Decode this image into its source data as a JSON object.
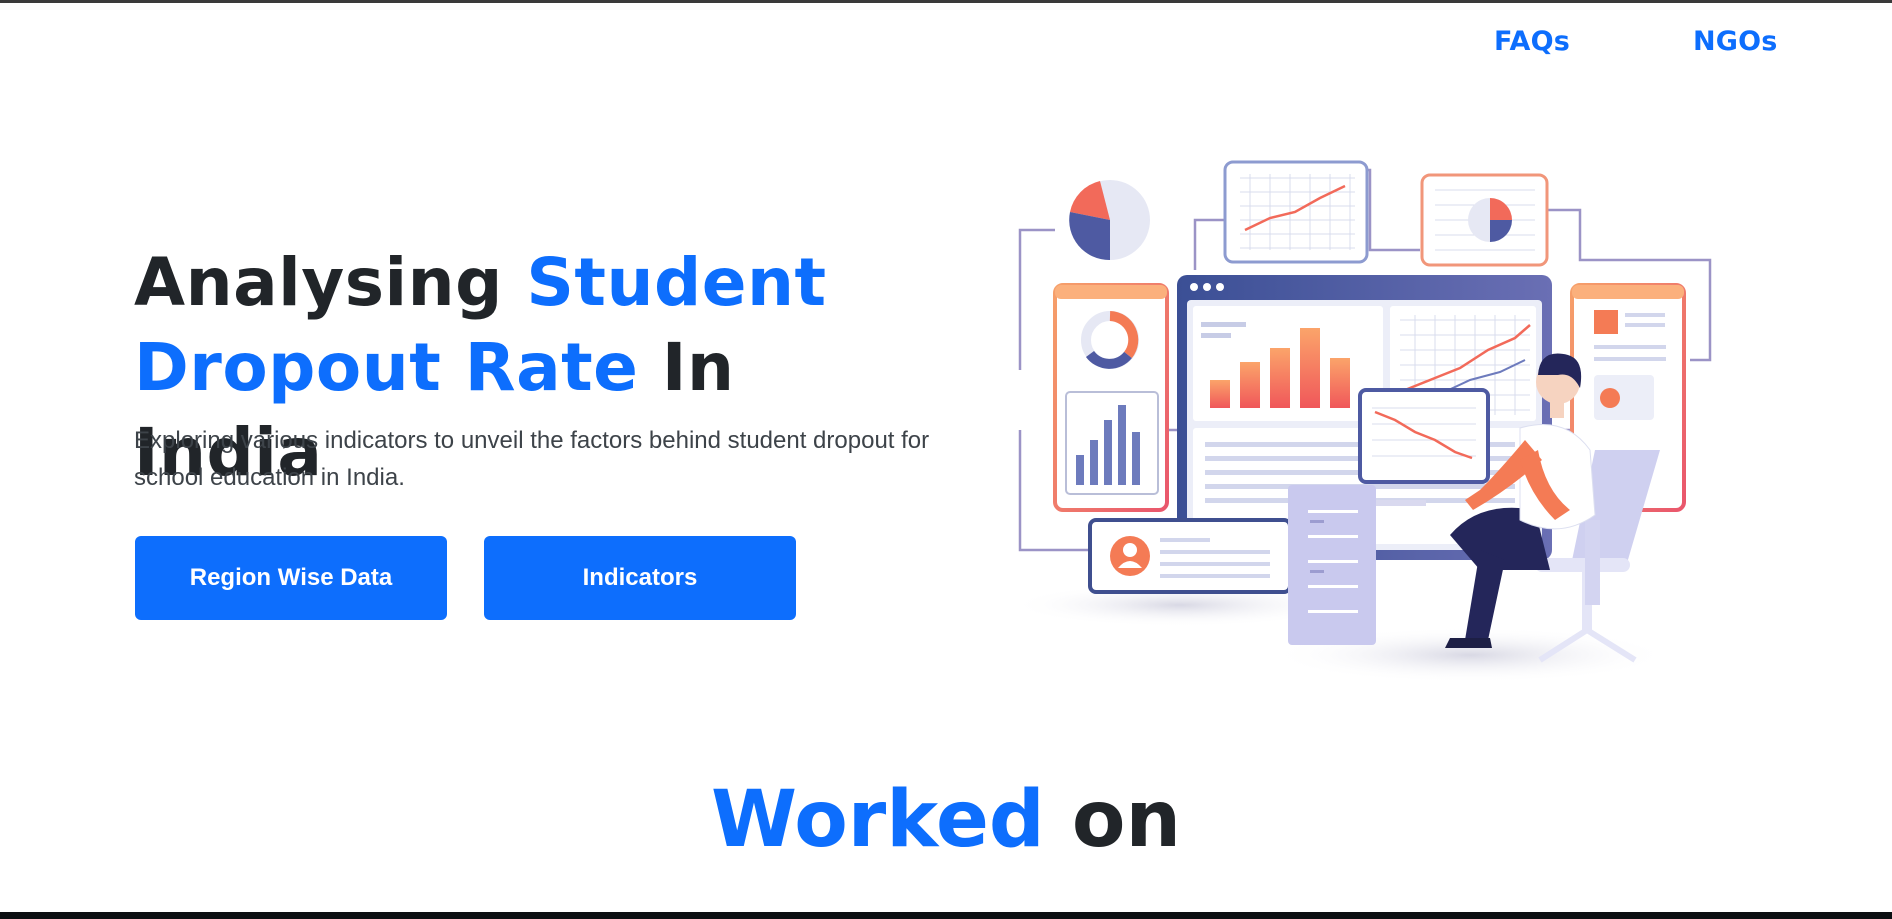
{
  "nav": {
    "faq_label": "FAQs",
    "ngo_label": "NGOs"
  },
  "hero": {
    "title_part1": "Analysing ",
    "title_accent": "Student Dropout Rate",
    "title_part2": " In India",
    "subtitle": "Exploring various indicators to unveil the factors behind student dropout for school education in India.",
    "buttons": {
      "region_label": "Region Wise Data",
      "indicators_label": "Indicators"
    }
  },
  "section": {
    "title_accent": "Worked",
    "title_rest": " on"
  },
  "colors": {
    "accent": "#0d6efd",
    "text_dark": "#212529",
    "illustration_orange": "#f4784b",
    "illustration_navy": "#2e3a74",
    "illustration_lavender": "#c5c5ea"
  },
  "illustration": {
    "icon": "data-analytics-illustration"
  }
}
